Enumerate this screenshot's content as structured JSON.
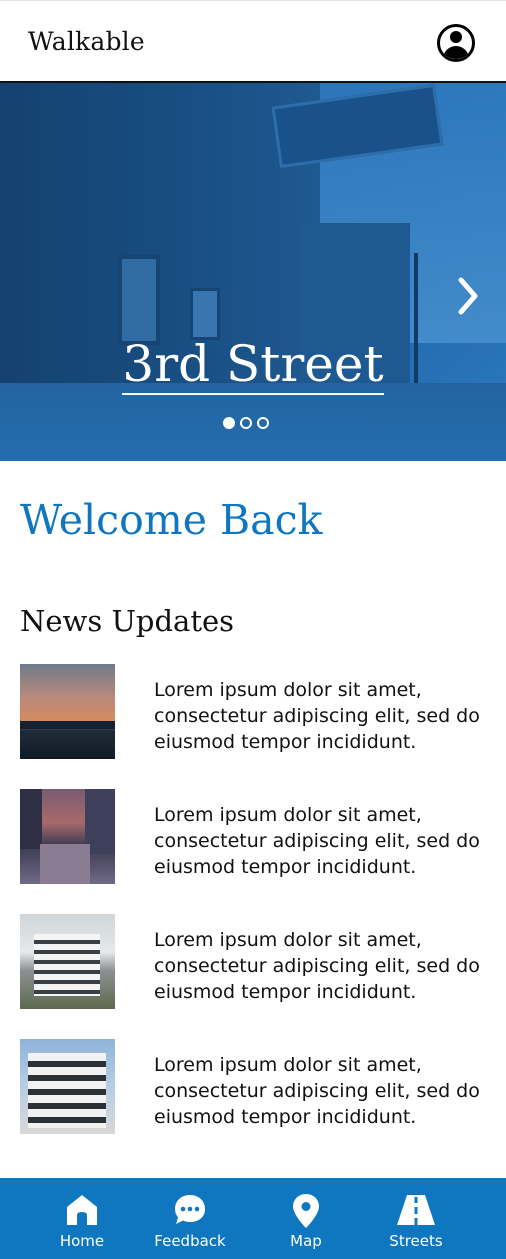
{
  "header": {
    "brand": "Walkable",
    "profile_icon": "user-circle-icon"
  },
  "hero": {
    "title": "3rd Street",
    "slide_count": 3,
    "active_slide": 1,
    "next_icon": "chevron-right-icon"
  },
  "welcome": {
    "title": "Welcome Back"
  },
  "news": {
    "title": "News Updates",
    "items": [
      {
        "text": "Lorem ipsum dolor sit amet, consectetur adipiscing elit, sed do eiusmod tempor incididunt."
      },
      {
        "text": "Lorem ipsum dolor sit amet, consectetur adipiscing elit, sed do eiusmod tempor incididunt."
      },
      {
        "text": "Lorem ipsum dolor sit amet, consectetur adipiscing elit, sed do eiusmod tempor incididunt."
      },
      {
        "text": "Lorem ipsum dolor sit amet, consectetur adipiscing elit, sed do eiusmod tempor incididunt."
      }
    ]
  },
  "nav": {
    "items": [
      {
        "label": "Home",
        "icon": "home-icon"
      },
      {
        "label": "Feedback",
        "icon": "chat-icon"
      },
      {
        "label": "Map",
        "icon": "map-pin-icon"
      },
      {
        "label": "Streets",
        "icon": "road-icon"
      }
    ]
  },
  "colors": {
    "accent": "#0f77bf",
    "hero_tint": "#1e5a8f",
    "text": "#111111",
    "background": "#ffffff"
  }
}
